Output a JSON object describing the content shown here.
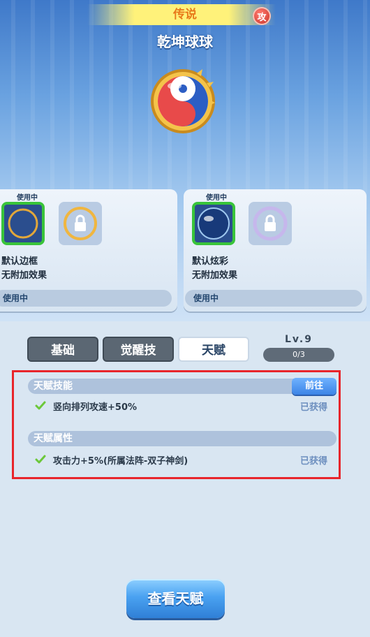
{
  "header": {
    "rarity": "传说",
    "attack_badge": "攻",
    "item_name": "乾坤球球",
    "orb_icon": "yin-yang-orb-icon"
  },
  "cards": [
    {
      "using_tag": "使用中",
      "name": "默认边框",
      "effect": "无附加效果",
      "status": "使用中"
    },
    {
      "using_tag": "使用中",
      "name": "默认炫彩",
      "effect": "无附加效果",
      "status": "使用中"
    }
  ],
  "tabs": [
    {
      "label": "基础",
      "selected": false
    },
    {
      "label": "觉醒技",
      "selected": false
    },
    {
      "label": "天赋",
      "selected": true
    }
  ],
  "level": {
    "label": "Lv.9",
    "progress_text": "0/3"
  },
  "talent_skill": {
    "title": "天赋技能",
    "go_label": "前往",
    "items": [
      {
        "text": "竖向排列攻速+50%",
        "status": "已获得"
      }
    ]
  },
  "talent_attr": {
    "title": "天赋属性",
    "items": [
      {
        "text": "攻击力+5%(所属法阵-双子神剑)",
        "status": "已获得"
      }
    ]
  },
  "view_button": "查看天赋",
  "colors": {
    "accent_blue": "#3c84e6",
    "highlight_red": "#e8252b",
    "active_green": "#39c43a"
  }
}
